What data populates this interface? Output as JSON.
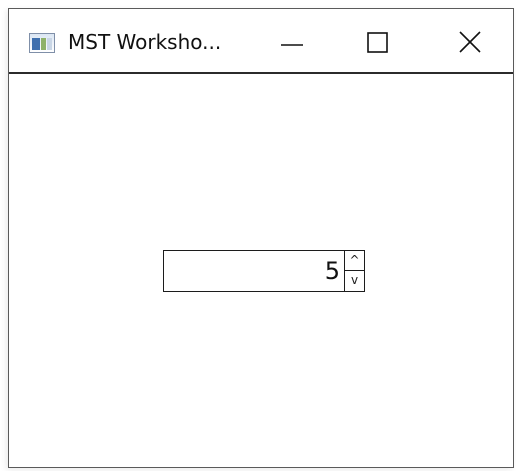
{
  "window": {
    "title": "MST Worksho...",
    "controls": {
      "minimize_icon": "minimize-icon",
      "maximize_icon": "maximize-icon",
      "close_icon": "close-icon"
    }
  },
  "spinner": {
    "value": "5",
    "up_glyph": "^",
    "down_glyph": "v"
  }
}
